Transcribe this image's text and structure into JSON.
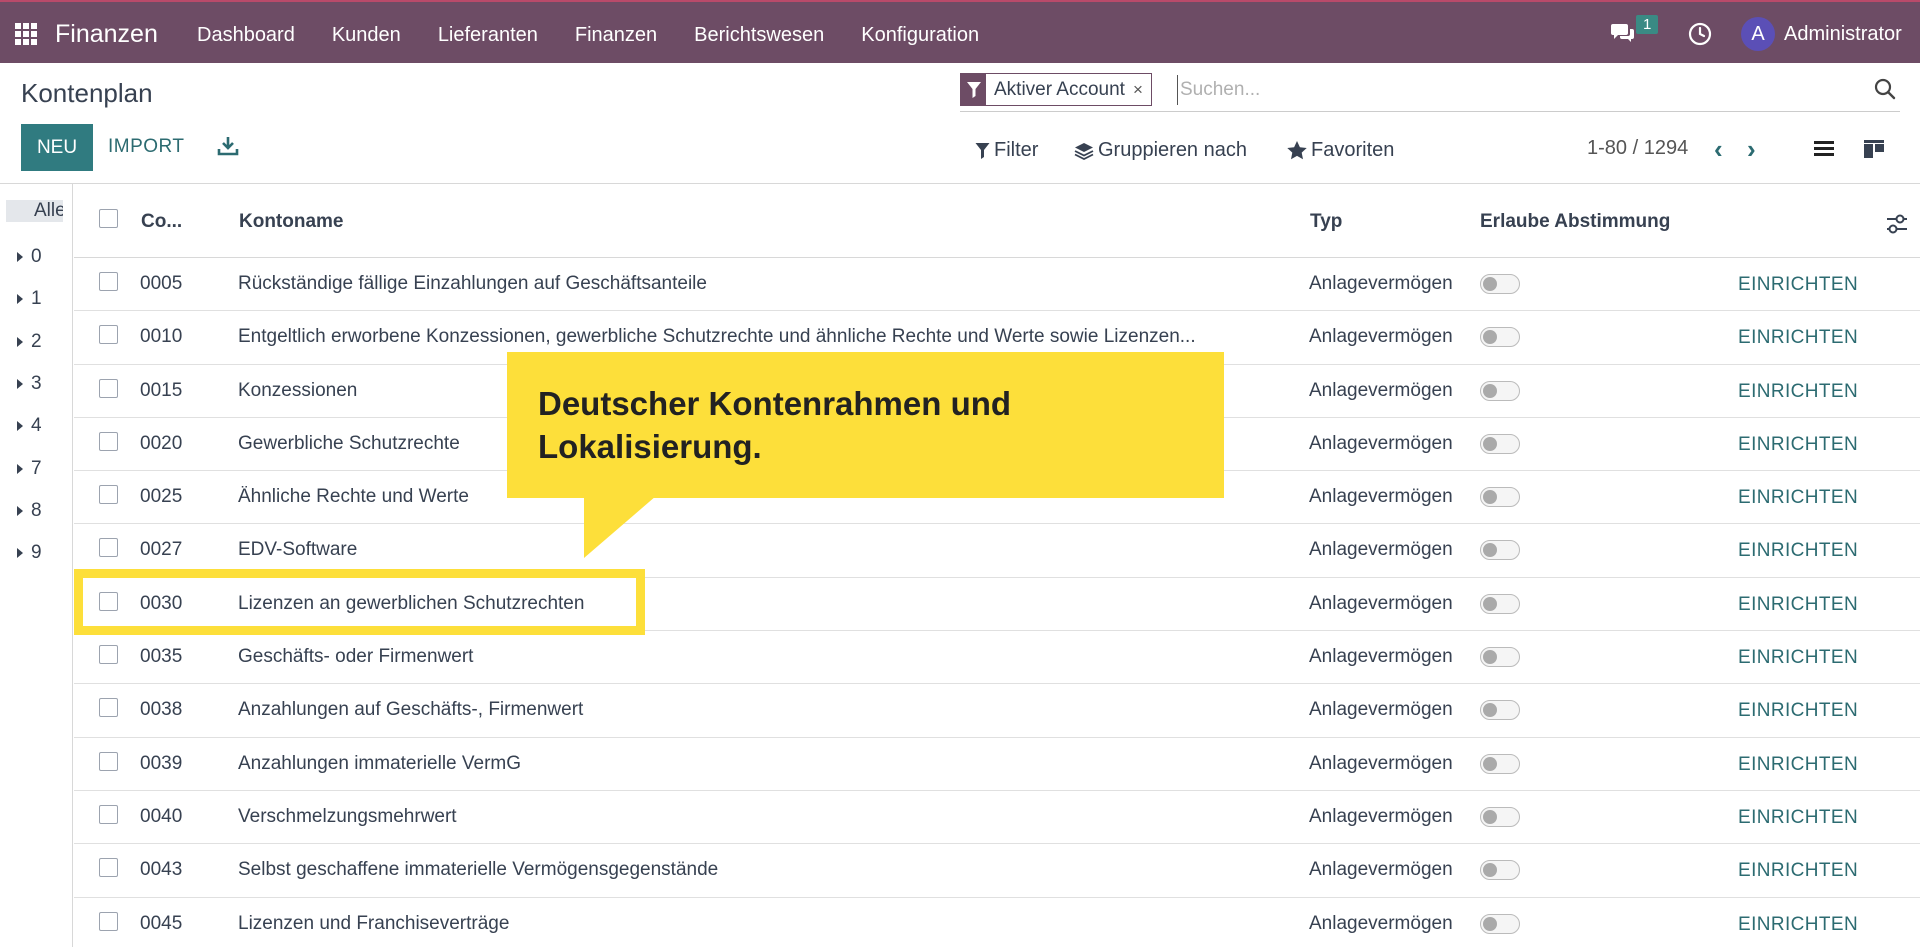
{
  "nav": {
    "brand": "Finanzen",
    "menu": [
      "Dashboard",
      "Kunden",
      "Lieferanten",
      "Finanzen",
      "Berichtswesen",
      "Konfiguration"
    ],
    "chat_badge": "1",
    "avatar_letter": "A",
    "user": "Administrator"
  },
  "control": {
    "title": "Kontenplan",
    "facet": "Aktiver Account",
    "facet_close": "×",
    "search_placeholder": "Suchen...",
    "new_label": "NEU",
    "import_label": "IMPORT",
    "filter_label": "Filter",
    "group_label": "Gruppieren nach",
    "favorites_label": "Favoriten",
    "pager": "1-80 / 1294",
    "pager_prev": "‹",
    "pager_next": "›"
  },
  "sidebar": {
    "all": "Alle",
    "items": [
      "0",
      "1",
      "2",
      "3",
      "4",
      "7",
      "8",
      "9"
    ]
  },
  "table": {
    "headers": {
      "code": "Co...",
      "name": "Kontoname",
      "type": "Typ",
      "reconcile": "Erlaube Abstimmung"
    },
    "setup_label": "EINRICHTEN",
    "rows": [
      {
        "code": "0005",
        "name": "Rückständige fällige Einzahlungen auf Geschäftsanteile",
        "type": "Anlagevermögen"
      },
      {
        "code": "0010",
        "name": "Entgeltlich erworbene Konzessionen, gewerbliche Schutzrechte und ähnliche Rechte und Werte sowie Lizenzen...",
        "type": "Anlagevermögen"
      },
      {
        "code": "0015",
        "name": "Konzessionen",
        "type": "Anlagevermögen"
      },
      {
        "code": "0020",
        "name": "Gewerbliche Schutzrechte",
        "type": "Anlagevermögen"
      },
      {
        "code": "0025",
        "name": "Ähnliche Rechte und Werte",
        "type": "Anlagevermögen"
      },
      {
        "code": "0027",
        "name": "EDV-Software",
        "type": "Anlagevermögen"
      },
      {
        "code": "0030",
        "name": "Lizenzen an gewerblichen Schutzrechten",
        "type": "Anlagevermögen"
      },
      {
        "code": "0035",
        "name": "Geschäfts- oder Firmenwert",
        "type": "Anlagevermögen"
      },
      {
        "code": "0038",
        "name": "Anzahlungen auf Geschäfts-, Firmenwert",
        "type": "Anlagevermögen"
      },
      {
        "code": "0039",
        "name": "Anzahlungen immaterielle VermG",
        "type": "Anlagevermögen"
      },
      {
        "code": "0040",
        "name": "Verschmelzungsmehrwert",
        "type": "Anlagevermögen"
      },
      {
        "code": "0043",
        "name": "Selbst geschaffene immaterielle Vermögensgegenstände",
        "type": "Anlagevermögen"
      },
      {
        "code": "0045",
        "name": "Lizenzen und Franchiseverträge",
        "type": "Anlagevermögen"
      }
    ]
  },
  "callout": {
    "line1": "Deutscher Kontenrahmen und",
    "line2": "Lokalisierung."
  },
  "colors": {
    "navbar": "#6d4c65",
    "accent": "#307b80",
    "callout": "#fddf3a"
  }
}
